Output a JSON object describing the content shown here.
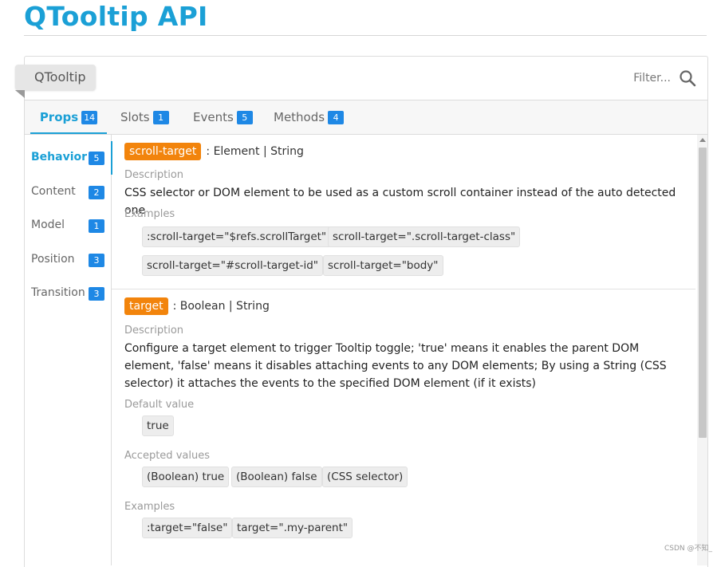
{
  "page": {
    "title": "QTooltip API"
  },
  "header": {
    "component_name": "QTooltip",
    "filter_placeholder": "Filter...",
    "search_icon": "search-icon"
  },
  "tabs": [
    {
      "label": "Props",
      "count": "14",
      "active": true
    },
    {
      "label": "Slots",
      "count": "1"
    },
    {
      "label": "Events",
      "count": "5"
    },
    {
      "label": "Methods",
      "count": "4"
    }
  ],
  "sidebar": {
    "items": [
      {
        "label": "Behavior",
        "count": "5",
        "active": true
      },
      {
        "label": "Content",
        "count": "2"
      },
      {
        "label": "Model",
        "count": "1"
      },
      {
        "label": "Position",
        "count": "3"
      },
      {
        "label": "Transition",
        "count": "3"
      }
    ]
  },
  "props": [
    {
      "name": "scroll-target",
      "type": ": Element | String",
      "description_label": "Description",
      "description": "CSS selector or DOM element to be used as a custom scroll container instead of the auto detected one",
      "examples_label": "Examples",
      "examples": [
        ":scroll-target=\"$refs.scrollTarget\"",
        "scroll-target=\".scroll-target-class\"",
        "scroll-target=\"#scroll-target-id\"",
        "scroll-target=\"body\""
      ]
    },
    {
      "name": "target",
      "type": ": Boolean | String",
      "description_label": "Description",
      "description": "Configure a target element to trigger Tooltip toggle; 'true' means it enables the parent DOM element, 'false' means it disables attaching events to any DOM elements; By using a String (CSS selector) it attaches the events to the specified DOM element (if it exists)",
      "default_label": "Default value",
      "default_value": "true",
      "accepted_label": "Accepted values",
      "accepted": [
        "(Boolean) true",
        "(Boolean) false",
        "(CSS selector)"
      ],
      "examples_label": "Examples",
      "examples": [
        ":target=\"false\"",
        "target=\".my-parent\""
      ]
    }
  ],
  "watermark": "CSDN @不知_",
  "colors": {
    "accent": "#1ba0d6",
    "badge": "#1e88e5",
    "prop_name": "#f2840c"
  }
}
